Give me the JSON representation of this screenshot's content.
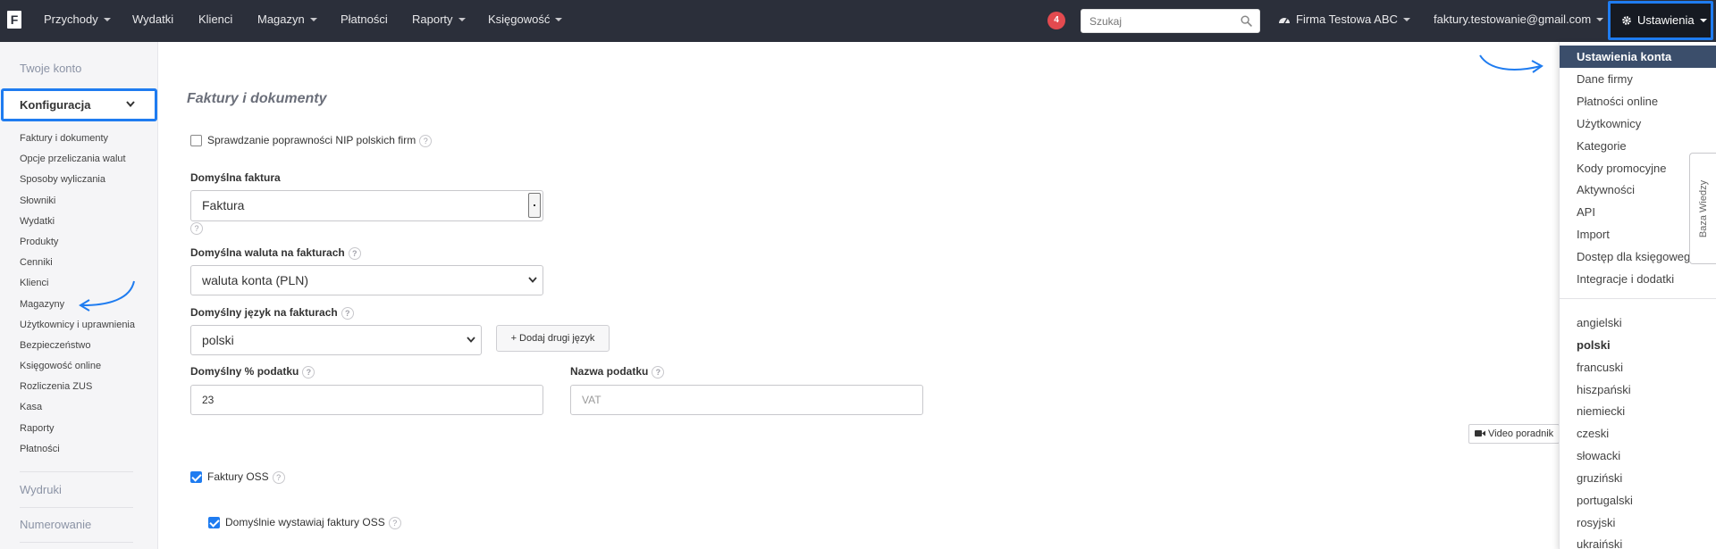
{
  "topbar": {
    "logo": "F",
    "nav": [
      "Przychody",
      "Wydatki",
      "Klienci",
      "Magazyn",
      "Płatności",
      "Raporty",
      "Księgowość"
    ],
    "notifications": "4",
    "search_placeholder": "Szukaj",
    "company": "Firma Testowa ABC",
    "user_email": "faktury.testowanie@gmail.com",
    "settings_label": "Ustawienia"
  },
  "sidebar": {
    "account": "Twoje konto",
    "config": "Konfiguracja",
    "items": [
      "Faktury i dokumenty",
      "Opcje przeliczania walut",
      "Sposoby wyliczania",
      "Słowniki",
      "Wydatki",
      "Produkty",
      "Cenniki",
      "Klienci",
      "Magazyny",
      "Użytkownicy i uprawnienia",
      "Bezpieczeństwo",
      "Księgowość online",
      "Rozliczenia ZUS",
      "Kasa",
      "Raporty",
      "Płatności"
    ],
    "prints": "Wydruki",
    "numbering": "Numerowanie"
  },
  "main": {
    "title": "Faktury i dokumenty",
    "nip_check": "Sprawdzanie poprawności NIP polskich firm",
    "default_invoice_label": "Domyślna faktura",
    "default_invoice_value": "Faktura",
    "default_currency_label": "Domyślna waluta na fakturach",
    "default_currency_value": "waluta konta (PLN)",
    "default_language_label": "Domyślny język na fakturach",
    "default_language_value": "polski",
    "add_second_language": "+ Dodaj drugi język",
    "default_tax_label": "Domyślny % podatku",
    "default_tax_value": "23",
    "tax_name_label": "Nazwa podatku",
    "tax_name_placeholder": "VAT",
    "video_guide": "Video poradnik",
    "oss_invoices": "Faktury OSS",
    "oss_default": "Domyślnie wystawiaj faktury OSS",
    "help_mark": "?"
  },
  "settings_menu": {
    "items": [
      "Ustawienia konta",
      "Dane firmy",
      "Płatności online",
      "Użytkownicy",
      "Kategorie",
      "Kody promocyjne",
      "Aktywności",
      "API",
      "Import",
      "Dostęp dla księgowego",
      "Integracje i dodatki"
    ],
    "languages": [
      "angielski",
      "polski",
      "francuski",
      "hiszpański",
      "niemiecki",
      "czeski",
      "słowacki",
      "gruziński",
      "portugalski",
      "rosyjski",
      "ukraiński"
    ]
  },
  "side_tab": "Baza Wiedzy",
  "colors": {
    "topbar": "#2b2f3a",
    "highlight": "#1f7cf0",
    "active_menu": "#3b4e6b",
    "badge": "#e34a4f"
  }
}
